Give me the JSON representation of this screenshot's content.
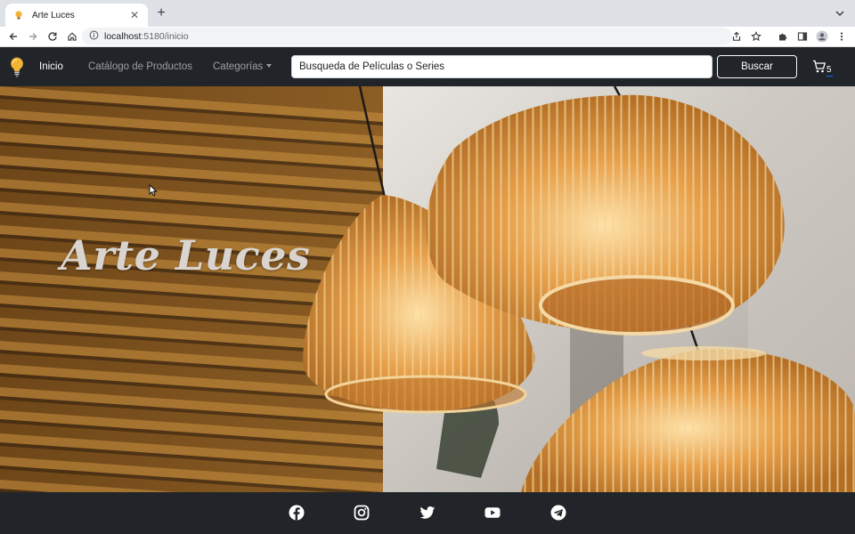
{
  "browser": {
    "tab_title": "Arte Luces",
    "url_host": "localhost",
    "url_rest": ":5180/inicio",
    "icons": [
      "favicon-bulb-icon",
      "close-icon",
      "new-tab-icon",
      "tab-search-icon",
      "back-icon",
      "forward-icon",
      "reload-icon",
      "home-icon",
      "site-info-icon",
      "share-icon",
      "bookmark-star-icon",
      "extensions-icon",
      "side-panel-icon",
      "profile-icon",
      "more-menu-icon"
    ]
  },
  "navbar": {
    "brand_icon": "lightbulb-icon",
    "links": [
      {
        "label": "Inicio",
        "active": true
      },
      {
        "label": "Catálogo de Productos",
        "active": false
      },
      {
        "label": "Categorías",
        "active": false
      }
    ],
    "search_value": "Busqueda de Películas o Series",
    "search_button": "Buscar",
    "cart_icon": "cart-icon",
    "cart_count": "5"
  },
  "hero": {
    "title": "Arte Luces"
  },
  "footer": {
    "social": [
      "facebook-icon",
      "instagram-icon",
      "twitter-icon",
      "youtube-icon",
      "telegram-icon"
    ]
  },
  "colors": {
    "navbar_bg": "#212529",
    "footer_bg": "#212529",
    "chrome_tabstrip": "#dee1e6",
    "accent": "#0d6efd",
    "hero_wood": "#b07a35",
    "hero_lamp": "#e7b46a"
  }
}
